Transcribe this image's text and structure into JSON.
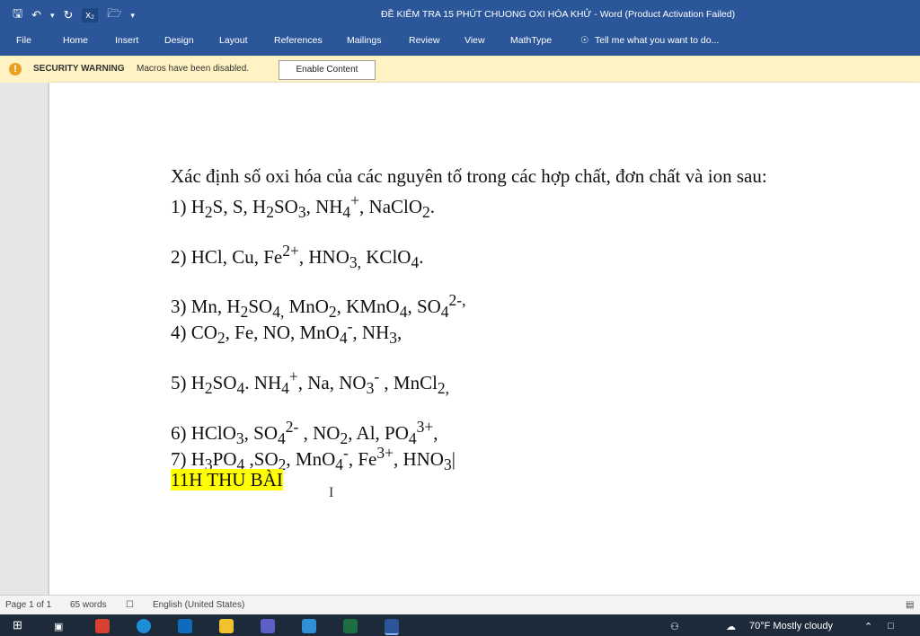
{
  "window": {
    "title": "ĐỀ KIỂM TRA 15 PHÚT CHUONG OXI HÓA KHỬ - Word (Product Activation Failed)"
  },
  "quick_access": {
    "save_icon": "save-icon",
    "undo_icon": "undo-icon",
    "redo_icon": "redo-icon",
    "subscript_label": "x₂",
    "open_icon": "folder-icon"
  },
  "ribbon": {
    "tabs": [
      "File",
      "Home",
      "Insert",
      "Design",
      "Layout",
      "References",
      "Mailings",
      "Review",
      "View",
      "MathType"
    ],
    "tell_me": "Tell me what you want to do..."
  },
  "security_bar": {
    "title": "SECURITY WARNING",
    "message": "Macros have been disabled.",
    "button": "Enable Content"
  },
  "document": {
    "intro": "Xác định số oxi hóa của các nguyên tố trong các hợp chất, đơn chất và ion sau:",
    "note": "11H THU BÀI"
  },
  "status_bar": {
    "page": "Page 1 of 1",
    "words": "65 words",
    "language": "English (United States)"
  },
  "taskbar": {
    "weather": "70°F  Mostly cloudy"
  },
  "colors": {
    "ribbon": "#2b579a",
    "highlight": "#ffff00",
    "security_bar": "#fff3c4"
  }
}
